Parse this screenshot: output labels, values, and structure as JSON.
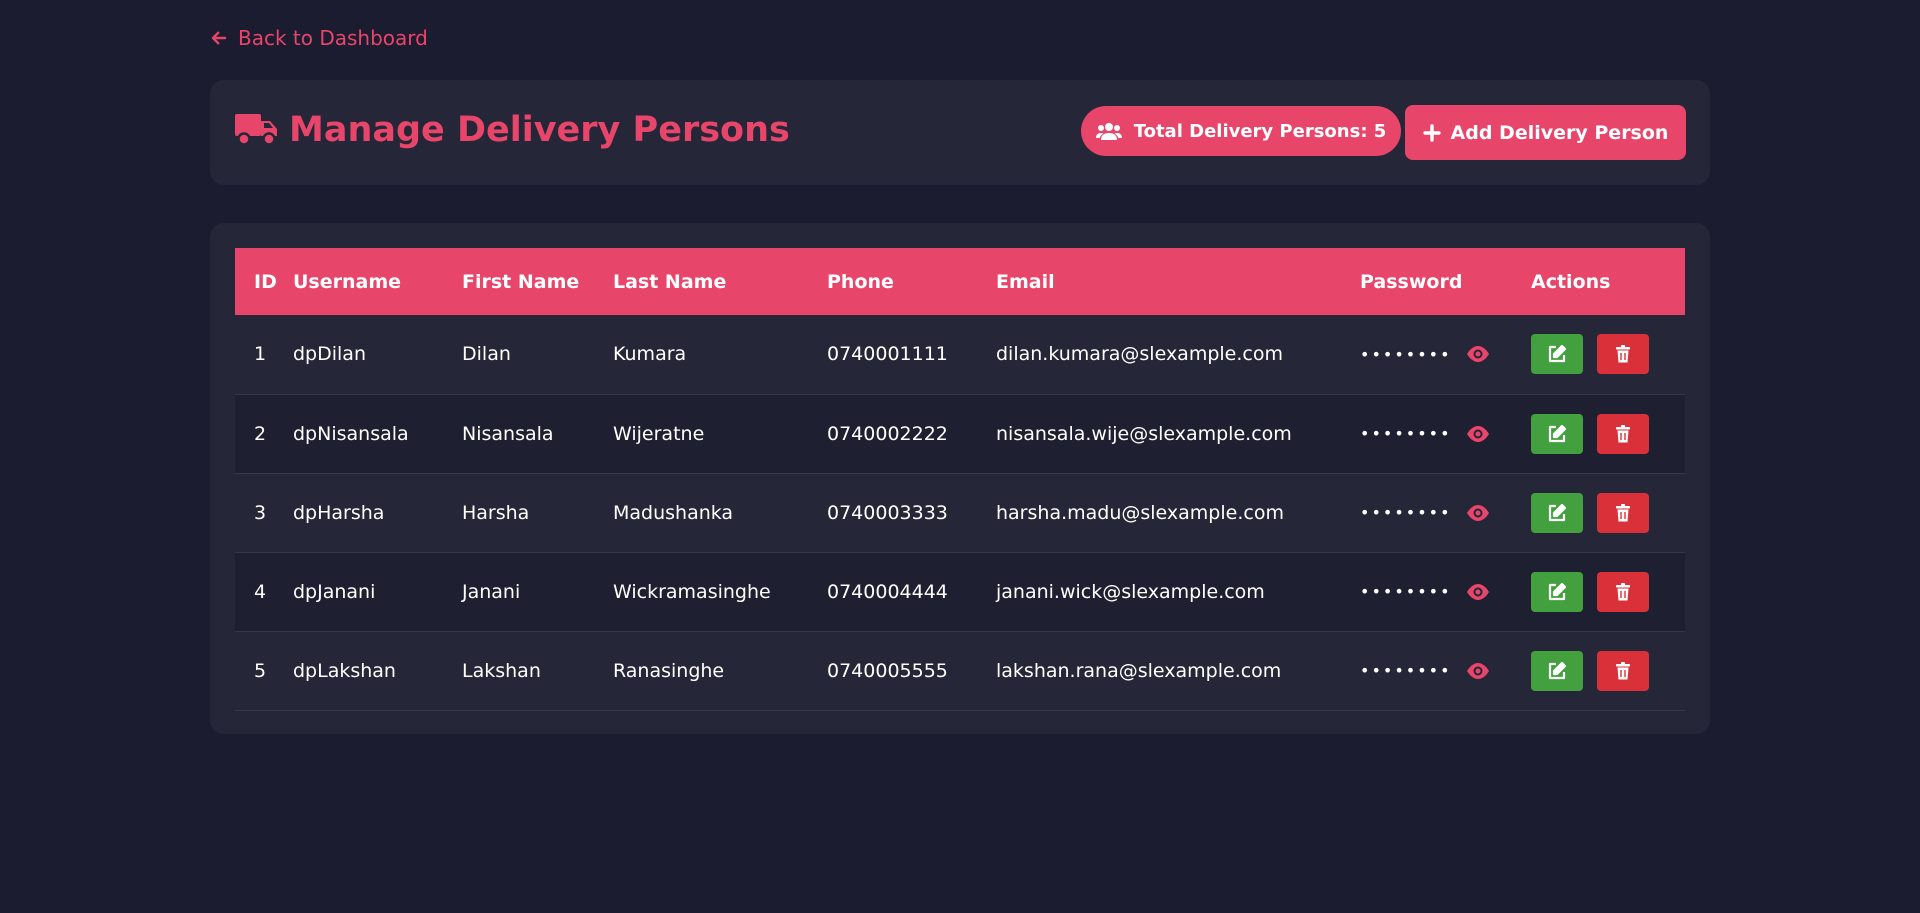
{
  "nav": {
    "back_label": "Back to Dashboard"
  },
  "header": {
    "title": "Manage Delivery Persons",
    "total_badge": "Total Delivery Persons: 5",
    "add_button": "Add Delivery Person"
  },
  "table": {
    "columns": [
      "ID",
      "Username",
      "First Name",
      "Last Name",
      "Phone",
      "Email",
      "Password",
      "Actions"
    ],
    "rows": [
      {
        "id": "1",
        "username": "dpDilan",
        "first": "Dilan",
        "last": "Kumara",
        "phone": "0740001111",
        "email": "dilan.kumara@slexample.com",
        "password": "••••••••"
      },
      {
        "id": "2",
        "username": "dpNisansala",
        "first": "Nisansala",
        "last": "Wijeratne",
        "phone": "0740002222",
        "email": "nisansala.wije@slexample.com",
        "password": "••••••••"
      },
      {
        "id": "3",
        "username": "dpHarsha",
        "first": "Harsha",
        "last": "Madushanka",
        "phone": "0740003333",
        "email": "harsha.madu@slexample.com",
        "password": "••••••••"
      },
      {
        "id": "4",
        "username": "dpJanani",
        "first": "Janani",
        "last": "Wickramasinghe",
        "phone": "0740004444",
        "email": "janani.wick@slexample.com",
        "password": "••••••••"
      },
      {
        "id": "5",
        "username": "dpLakshan",
        "first": "Lakshan",
        "last": "Ranasinghe",
        "phone": "0740005555",
        "email": "lakshan.rana@slexample.com",
        "password": "••••••••"
      }
    ]
  },
  "icons": {
    "back": "arrow-left-icon",
    "title": "truck-icon",
    "badge": "users-icon",
    "add": "plus-icon",
    "show_password": "eye-icon",
    "edit": "edit-icon",
    "delete": "trash-icon"
  },
  "colors": {
    "accent": "#e8456a",
    "background": "#1b1c2f",
    "card": "#252638",
    "edit": "#43a03f",
    "delete": "#d9303a"
  }
}
